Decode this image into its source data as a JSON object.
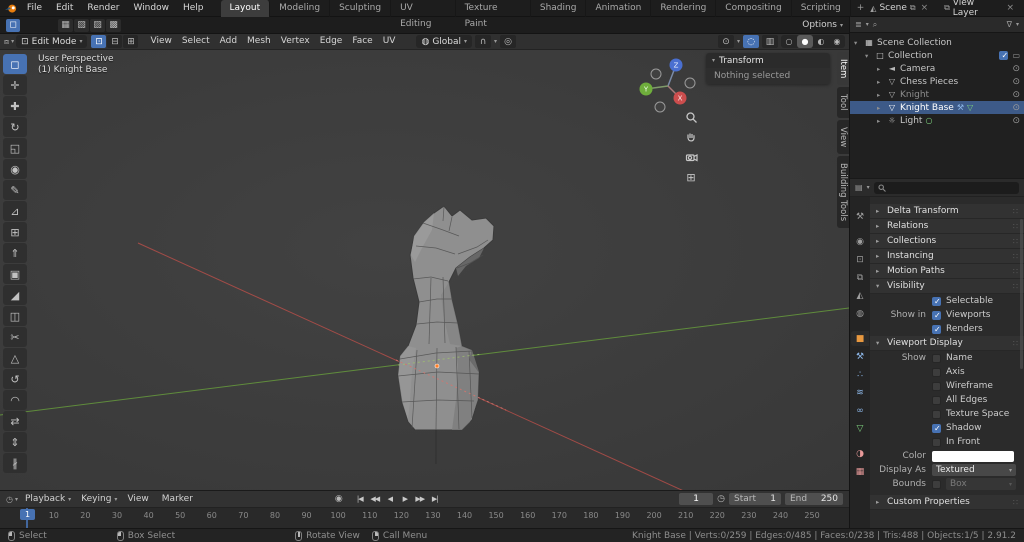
{
  "colors": {
    "accent": "#4772b3",
    "selection_blue": "#3d5a88",
    "object_orange": "#e8983f",
    "axis_x": "#cc4d4d",
    "axis_y": "#6fae3c",
    "axis_z": "#4a6fd0"
  },
  "ui": {
    "caret": "▾",
    "dots": "∷",
    "close": "×",
    "search": "⌕",
    "funnel": "∇",
    "eye": "⊙",
    "screen": "▭"
  },
  "topbar": {
    "menus": [
      {
        "label": "File"
      },
      {
        "label": "Edit"
      },
      {
        "label": "Render"
      },
      {
        "label": "Window"
      },
      {
        "label": "Help"
      }
    ],
    "workspaces": [
      {
        "label": "Layout",
        "active": true
      },
      {
        "label": "Modeling",
        "active": false
      },
      {
        "label": "Sculpting",
        "active": false
      },
      {
        "label": "UV Editing",
        "active": false
      },
      {
        "label": "Texture Paint",
        "active": false
      },
      {
        "label": "Shading",
        "active": false
      },
      {
        "label": "Animation",
        "active": false
      },
      {
        "label": "Rendering",
        "active": false
      },
      {
        "label": "Compositing",
        "active": false
      },
      {
        "label": "Scripting",
        "active": false
      }
    ],
    "add_workspace": "+",
    "scene": {
      "icon": "◭",
      "label": "Scene",
      "copy_icon": "⧉"
    },
    "view_layer": {
      "icon": "⧉",
      "label": "View Layer"
    }
  },
  "tool_settings": {
    "active_tool_glyph": "◻",
    "modes": [
      {
        "name": "select-mode-set",
        "glyph": "▦"
      },
      {
        "name": "select-mode-extend",
        "glyph": "▧"
      },
      {
        "name": "select-mode-subtract",
        "glyph": "▨"
      },
      {
        "name": "select-mode-intersect",
        "glyph": "▩"
      }
    ],
    "options_label": "Options"
  },
  "viewport_header": {
    "editor_icon": "⧈",
    "mode_icon": "⊡",
    "mode_label": "Edit Mode",
    "select_modes": [
      {
        "name": "vertex-select-toggle",
        "glyph": "⊡",
        "active": true
      },
      {
        "name": "edge-select-toggle",
        "glyph": "⊟",
        "active": false
      },
      {
        "name": "face-select-toggle",
        "glyph": "⊞",
        "active": false
      }
    ],
    "menus": [
      {
        "label": "View"
      },
      {
        "label": "Select"
      },
      {
        "label": "Add"
      },
      {
        "label": "Mesh"
      },
      {
        "label": "Vertex"
      },
      {
        "label": "Edge"
      },
      {
        "label": "Face"
      },
      {
        "label": "UV"
      }
    ],
    "orientation_icon": "◍",
    "orientation_label": "Global",
    "snap_icon": "∩",
    "proportional_icon": "◎",
    "gizmo_toggle_icon": "⊙",
    "xray_icon": "▥",
    "overlays_icon": "◌",
    "shading_modes": [
      {
        "name": "wireframe-shading-button",
        "glyph": "○",
        "active": false
      },
      {
        "name": "solid-shading-button",
        "glyph": "●",
        "active": true
      },
      {
        "name": "material-shading-button",
        "glyph": "◐",
        "active": false
      },
      {
        "name": "rendered-shading-button",
        "glyph": "◉",
        "active": false
      }
    ]
  },
  "viewport": {
    "perspective_label": "User Perspective",
    "active_object_label": "(1) Knight Base",
    "transform_panel": {
      "title": "Transform",
      "message": "Nothing selected"
    },
    "side_tabs": [
      {
        "label": "Item",
        "active": true
      },
      {
        "label": "Tool",
        "active": false
      },
      {
        "label": "View",
        "active": false
      },
      {
        "label": "Building Tools",
        "active": false
      }
    ],
    "gizmo_axes": {
      "x": "X",
      "y": "Y",
      "z": "Z"
    },
    "tools": [
      {
        "name": "tool-select-box",
        "glyph": "◻",
        "active": true
      },
      {
        "name": "tool-cursor",
        "glyph": "✛",
        "active": false
      },
      {
        "name": "tool-move",
        "glyph": "✚",
        "active": false
      },
      {
        "name": "tool-rotate",
        "glyph": "↻",
        "active": false
      },
      {
        "name": "tool-scale",
        "glyph": "◱",
        "active": false
      },
      {
        "name": "tool-transform",
        "glyph": "◉",
        "active": false
      },
      {
        "name": "tool-annotate",
        "glyph": "✎",
        "active": false
      },
      {
        "name": "tool-measure",
        "glyph": "⊿",
        "active": false
      },
      {
        "name": "tool-add-cube",
        "glyph": "⊞",
        "active": false
      },
      {
        "name": "tool-extrude-region",
        "glyph": "⇑",
        "active": false
      },
      {
        "name": "tool-inset-faces",
        "glyph": "▣",
        "active": false
      },
      {
        "name": "tool-bevel",
        "glyph": "◢",
        "active": false
      },
      {
        "name": "tool-loop-cut",
        "glyph": "◫",
        "active": false
      },
      {
        "name": "tool-knife",
        "glyph": "✂",
        "active": false
      },
      {
        "name": "tool-poly-build",
        "glyph": "△",
        "active": false
      },
      {
        "name": "tool-spin",
        "glyph": "↺",
        "active": false
      },
      {
        "name": "tool-smooth",
        "glyph": "◠",
        "active": false
      },
      {
        "name": "tool-edge-slide",
        "glyph": "⇄",
        "active": false
      },
      {
        "name": "tool-shrink-flatten",
        "glyph": "⇕",
        "active": false
      },
      {
        "name": "tool-rip-region",
        "glyph": "∦",
        "active": false
      }
    ]
  },
  "outliner": {
    "editor_icon": "≣",
    "rows": [
      {
        "label": "Scene Collection",
        "depth": 0,
        "arrow": "▾",
        "icon_name": "scene-collection-icon",
        "icon": "▦",
        "icon_color": "#cccccc"
      },
      {
        "label": "Collection",
        "depth": 1,
        "arrow": "▾",
        "icon_name": "collection-icon",
        "icon": "□",
        "icon_color": "#cccccc",
        "check": true,
        "screen": true
      },
      {
        "label": "Camera",
        "depth": 2,
        "arrow": "▸",
        "icon_name": "camera-icon",
        "icon": "◄",
        "icon_color": "#b8b8b8",
        "eye": true
      },
      {
        "label": "Chess Pieces",
        "depth": 2,
        "arrow": "▸",
        "icon_name": "mesh-icon",
        "icon": "▽",
        "icon_color": "#b8b8b8",
        "eye": true
      },
      {
        "label": "Knight",
        "depth": 2,
        "arrow": "▸",
        "icon_name": "mesh-icon",
        "icon": "▽",
        "icon_color": "#b8b8b8",
        "eye": true,
        "dim": true
      },
      {
        "label": "Knight Base",
        "depth": 2,
        "arrow": "▸",
        "icon_name": "mesh-icon",
        "icon": "▽",
        "icon_color": "#ffffff",
        "eye": true,
        "selected": true,
        "e1": {
          "has": true,
          "n": "modifier-wrench-icon",
          "g": "⚒",
          "c": "#8db7e8"
        },
        "e2": {
          "has": true,
          "n": "mesh-data-icon",
          "g": "▽",
          "c": "#7fd37f"
        }
      },
      {
        "label": "Light",
        "depth": 2,
        "arrow": "▸",
        "icon_name": "light-icon",
        "icon": "☼",
        "icon_color": "#b8b8b8",
        "eye": true,
        "e1": {
          "has": true,
          "n": "light-data-icon",
          "g": "○",
          "c": "#7fd37f"
        }
      }
    ]
  },
  "properties": {
    "tabs": [
      {
        "name": "tab-tool",
        "glyph": "⚒",
        "color": "#9e9e9e",
        "active": false,
        "gap": false
      },
      {
        "name": "tab-render",
        "glyph": "◉",
        "color": "#9e9e9e",
        "active": false,
        "gap": true
      },
      {
        "name": "tab-output",
        "glyph": "⊡",
        "color": "#9e9e9e",
        "active": false,
        "gap": false
      },
      {
        "name": "tab-view-layer",
        "glyph": "⧉",
        "color": "#9e9e9e",
        "active": false,
        "gap": false
      },
      {
        "name": "tab-scene",
        "glyph": "◭",
        "color": "#9e9e9e",
        "active": false,
        "gap": false
      },
      {
        "name": "tab-world",
        "glyph": "◍",
        "color": "#9e9e9e",
        "active": false,
        "gap": false
      },
      {
        "name": "tab-object",
        "glyph": "■",
        "color": "#e8983f",
        "active": true,
        "gap": true
      },
      {
        "name": "tab-modifiers",
        "glyph": "⚒",
        "color": "#8db7e8",
        "active": false,
        "gap": false
      },
      {
        "name": "tab-particles",
        "glyph": "∴",
        "color": "#8db7e8",
        "active": false,
        "gap": false
      },
      {
        "name": "tab-physics",
        "glyph": "≋",
        "color": "#8db7e8",
        "active": false,
        "gap": false
      },
      {
        "name": "tab-constraints",
        "glyph": "∞",
        "color": "#8db7e8",
        "active": false,
        "gap": false
      },
      {
        "name": "tab-object-data",
        "glyph": "▽",
        "color": "#7fd37f",
        "active": false,
        "gap": false
      },
      {
        "name": "tab-material",
        "glyph": "◑",
        "color": "#e89a9a",
        "active": false,
        "gap": true
      },
      {
        "name": "tab-texture",
        "glyph": "▦",
        "color": "#e89a9a",
        "active": false,
        "gap": false
      }
    ],
    "collapsed_panels": [
      {
        "label": "Delta Transform",
        "arrow": "▸"
      },
      {
        "label": "Relations",
        "arrow": "▸"
      },
      {
        "label": "Collections",
        "arrow": "▸"
      },
      {
        "label": "Instancing",
        "arrow": "▸"
      },
      {
        "label": "Motion Paths",
        "arrow": "▸"
      }
    ],
    "visibility": {
      "arrow": "▾",
      "title": "Visibility",
      "rows": [
        {
          "left": "",
          "label": "Selectable",
          "checked": true
        },
        {
          "left": "Show in",
          "label": "Viewports",
          "checked": true
        },
        {
          "left": "",
          "label": "Renders",
          "checked": true
        }
      ]
    },
    "viewport_display": {
      "arrow": "▾",
      "title": "Viewport Display",
      "checks": [
        {
          "left": "Show",
          "label": "Name",
          "checked": false
        },
        {
          "left": "",
          "label": "Axis",
          "checked": false
        },
        {
          "left": "",
          "label": "Wireframe",
          "checked": false
        },
        {
          "left": "",
          "label": "All Edges",
          "checked": false
        },
        {
          "left": "",
          "label": "Texture Space",
          "checked": false
        },
        {
          "left": "",
          "label": "Shadow",
          "checked": true
        },
        {
          "left": "",
          "label": "In Front",
          "checked": false
        }
      ],
      "color_label": "Color",
      "display_as_label": "Display As",
      "display_as_value": "Textured",
      "bounds_label": "Bounds",
      "bounds_checked": false,
      "bounds_value": "Box"
    },
    "custom_properties": {
      "label": "Custom Properties",
      "arrow": "▸"
    }
  },
  "timeline": {
    "editor_icon": "◷",
    "menus": [
      {
        "label": "Playback",
        "caret": "▾"
      },
      {
        "label": "Keying",
        "caret": "▾"
      },
      {
        "label": "View",
        "caret": ""
      },
      {
        "label": "Marker",
        "caret": ""
      }
    ],
    "record_icon": "◉",
    "playback": [
      {
        "name": "jump-to-start-button",
        "glyph": "|◀"
      },
      {
        "name": "previous-keyframe-button",
        "glyph": "◀◀"
      },
      {
        "name": "play-reverse-button",
        "glyph": "◀"
      },
      {
        "name": "play-button",
        "glyph": "▶"
      },
      {
        "name": "next-keyframe-button",
        "glyph": "▶▶"
      },
      {
        "name": "jump-to-end-button",
        "glyph": "▶|"
      }
    ],
    "current_frame": "1",
    "start_label": "Start",
    "start_value": "1",
    "end_label": "End",
    "end_value": "250",
    "ticks": [
      "10",
      "20",
      "30",
      "40",
      "50",
      "60",
      "70",
      "80",
      "90",
      "100",
      "110",
      "120",
      "130",
      "140",
      "150",
      "160",
      "170",
      "180",
      "190",
      "200",
      "210",
      "220",
      "230",
      "240",
      "250"
    ]
  },
  "statusbar": {
    "left": [
      {
        "icon": "left-mouse-icon",
        "label": "Select"
      },
      {
        "icon": "left-mouse-drag-icon",
        "label": "Box Select"
      },
      {
        "icon": "middle-mouse-icon",
        "label": "Rotate View"
      },
      {
        "icon": "right-mouse-icon",
        "label": "Call Menu"
      }
    ],
    "stats": "Knight Base | Verts:0/259 | Edges:0/485 | Faces:0/238 | Tris:488 | Objects:1/5 | 2.91.2"
  }
}
